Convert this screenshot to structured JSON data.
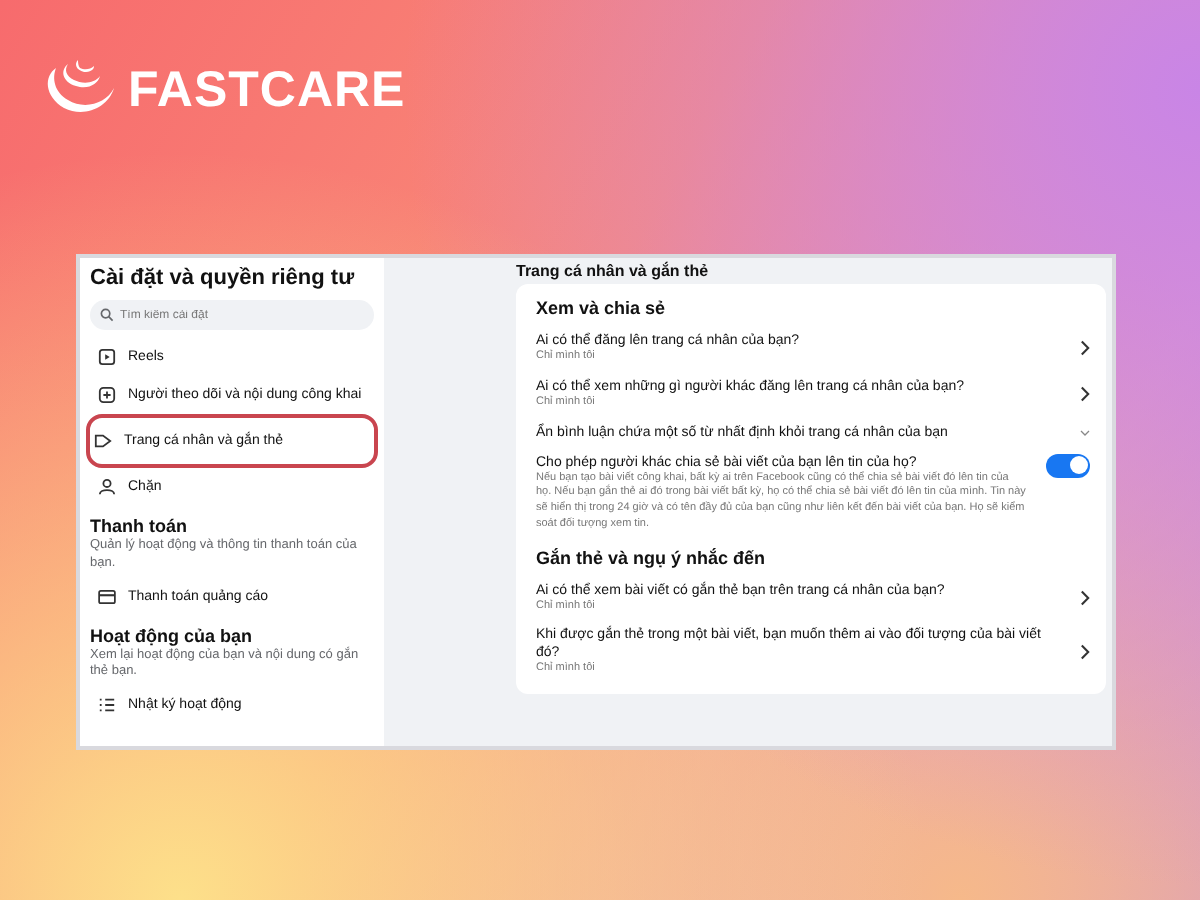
{
  "brand": {
    "name": "FASTCARE"
  },
  "sidebar": {
    "title": "Cài đặt và quyền riêng tư",
    "search": {
      "placeholder": "Tìm kiếm cài đặt"
    },
    "items": [
      {
        "kind": "item",
        "label": "Reels",
        "selected": false
      },
      {
        "kind": "item",
        "label": "Người theo dõi và nội dung công khai",
        "selected": false
      },
      {
        "kind": "item",
        "label": "Trang cá nhân và gắn thẻ",
        "selected": true
      },
      {
        "kind": "item",
        "label": "Chặn",
        "selected": false
      },
      {
        "kind": "heading",
        "label": "Thanh toán",
        "description": "Quản lý hoạt động và thông tin thanh toán của bạn."
      },
      {
        "kind": "item",
        "label": "Thanh toán quảng cáo",
        "selected": false
      },
      {
        "kind": "heading",
        "label": "Hoạt động của bạn",
        "description": "Xem lại hoạt động của bạn và nội dung có gắn thẻ bạn."
      },
      {
        "kind": "item",
        "label": "Nhật ký hoạt động",
        "selected": false
      }
    ]
  },
  "content": {
    "title": "Trang cá nhân và gắn thẻ",
    "sections": [
      {
        "title": "Xem và chia sẻ",
        "rows": [
          {
            "kind": "link",
            "title": "Ai có thể đăng lên trang cá nhân của bạn?",
            "subtitle": "Chỉ mình tôi"
          },
          {
            "kind": "link",
            "title": "Ai có thể xem những gì người khác đăng lên trang cá nhân của bạn?",
            "subtitle": "Chỉ mình tôi"
          },
          {
            "kind": "expand",
            "title": "Ẩn bình luận chứa một số từ nhất định khỏi trang cá nhân của bạn",
            "expanded": false
          },
          {
            "kind": "toggle",
            "title": "Cho phép người khác chia sẻ bài viết của bạn lên tin của họ?",
            "subtitle": "Nếu bạn tạo bài viết công khai, bất kỳ ai trên Facebook cũng có thể chia sẻ bài viết đó lên tin của họ. Nếu bạn gắn thẻ ai đó trong bài viết bất kỳ, họ có thể chia sẻ bài viết đó lên tin của mình. Tin này sẽ hiển thị trong 24 giờ và có tên đầy đủ của bạn cũng như liên kết đến bài viết của bạn. Họ sẽ kiểm soát đối tượng xem tin.",
            "on": true
          }
        ]
      },
      {
        "title": "Gắn thẻ và ngụ ý nhắc đến",
        "rows": [
          {
            "kind": "link",
            "title": "Ai có thể xem bài viết có gắn thẻ bạn trên trang cá nhân của bạn?",
            "subtitle": "Chỉ mình tôi"
          },
          {
            "kind": "link",
            "title": "Khi được gắn thẻ trong một bài viết, bạn muốn thêm ai vào đối tượng của bài viết đó?",
            "subtitle": "Chỉ mình tôi"
          }
        ]
      }
    ]
  }
}
